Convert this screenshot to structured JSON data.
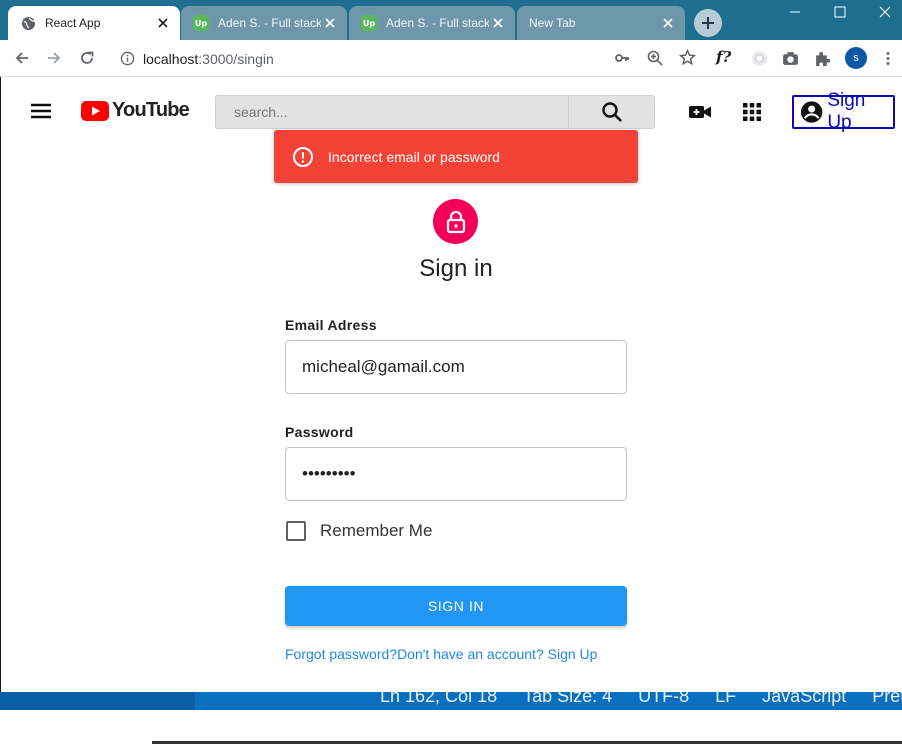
{
  "browser": {
    "tabs": [
      {
        "title": "React App",
        "favicon": "globe-icon",
        "active": true
      },
      {
        "title": "Aden S. - Full stack",
        "favicon": "upwork-icon",
        "active": false
      },
      {
        "title": "Aden S. - Full stack",
        "favicon": "upwork-icon",
        "active": false
      },
      {
        "title": "New Tab",
        "favicon": "",
        "active": false
      }
    ],
    "upwork_badge": "Up",
    "url_host": "localhost",
    "url_path": ":3000/singin",
    "profile_initial": "s",
    "extension_label": "f?"
  },
  "header": {
    "logo_text": "YouTube",
    "search_placeholder": "search...",
    "signup_label": "Sign Up"
  },
  "alert": {
    "message": "Incorrect email or password",
    "color": "#f44336"
  },
  "form": {
    "title": "Sign in",
    "email_label": "Email Adress",
    "email_value": "micheal@gamail.com",
    "password_label": "Password",
    "password_value": "•••••••••",
    "remember_label": "Remember Me",
    "remember_checked": false,
    "submit_label": "SIGN IN",
    "forgot_link": "Forgot password?",
    "signup_link": "Don't have an account? Sign Up"
  },
  "statusbar": {
    "items": [
      "Ln 162, Col 18",
      "Tab Size: 4",
      "UTF-8",
      "LF",
      "JavaScript",
      "Prettier: ✓"
    ]
  },
  "colors": {
    "accent": "#2196f3",
    "lock_avatar": "#f50057",
    "youtube_red": "#ff0000",
    "signup_border": "#0b0bb3"
  }
}
